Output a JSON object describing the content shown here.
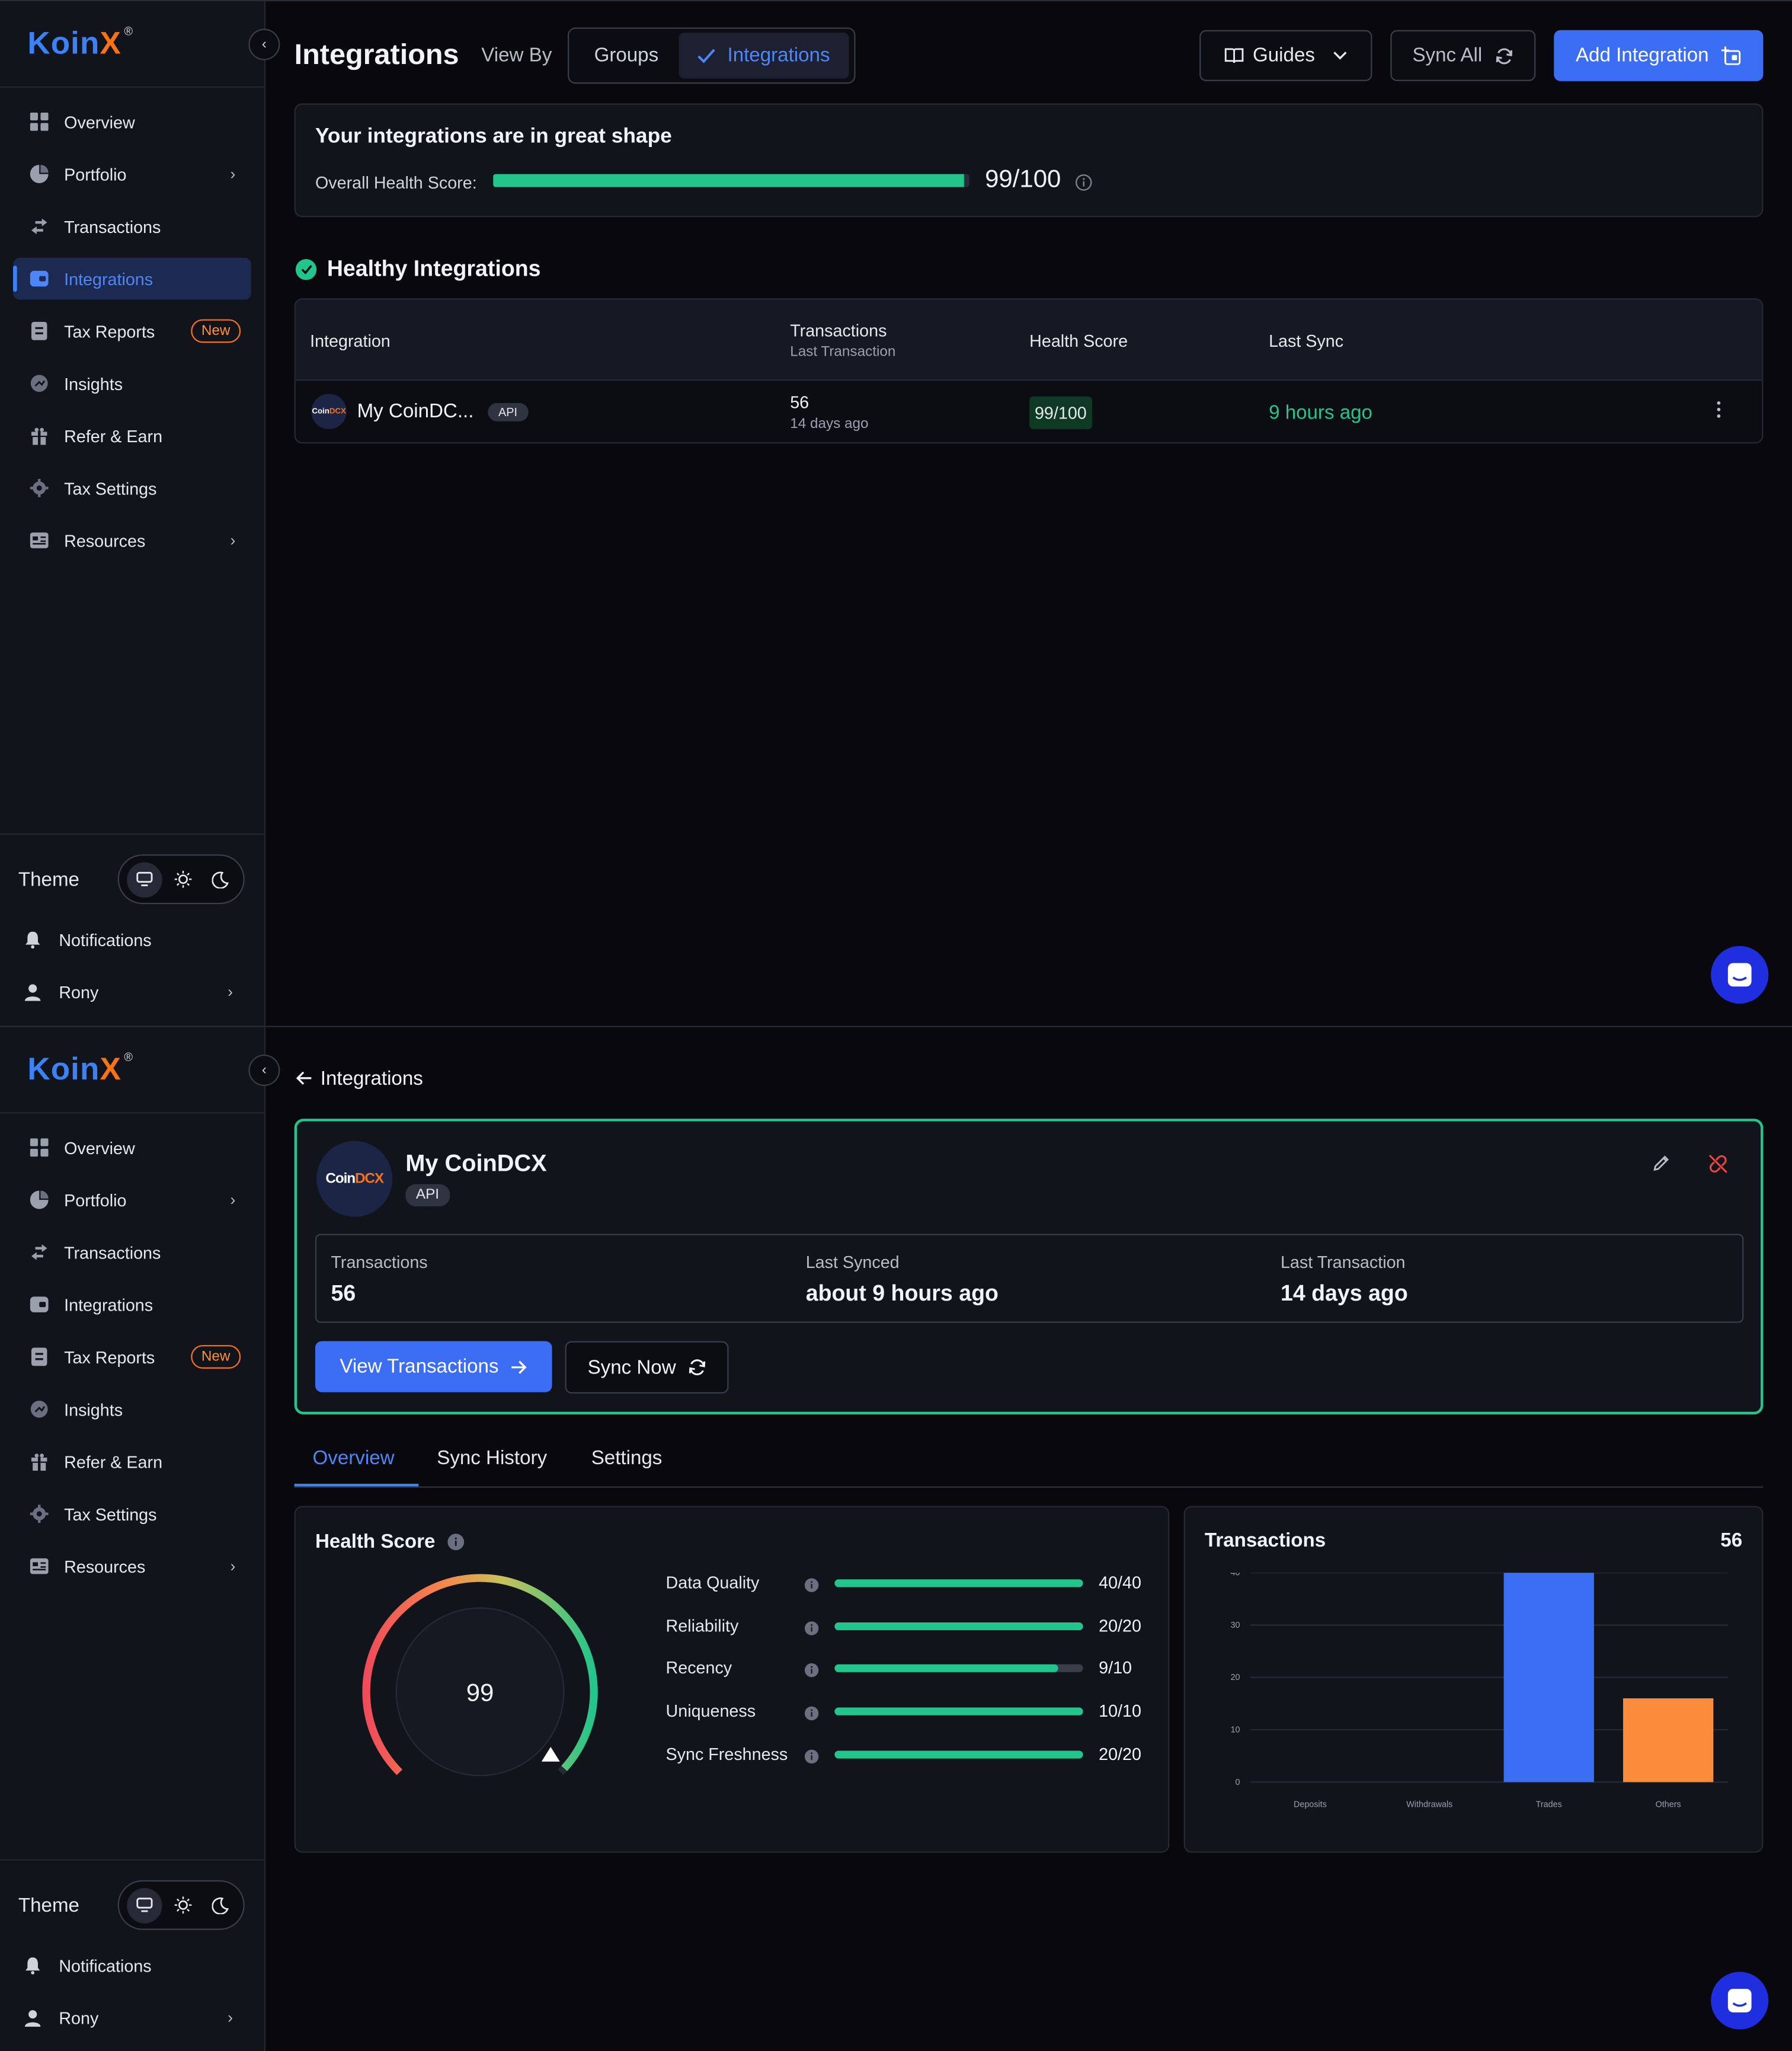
{
  "brand": {
    "name_prefix": "Koin",
    "name_suffix": "X",
    "reg": "®"
  },
  "sidebar": {
    "items": [
      {
        "label": "Overview",
        "icon": "overview-icon"
      },
      {
        "label": "Portfolio",
        "icon": "portfolio-icon",
        "has_submenu": true
      },
      {
        "label": "Transactions",
        "icon": "transactions-icon"
      },
      {
        "label": "Integrations",
        "icon": "integrations-icon"
      },
      {
        "label": "Tax Reports",
        "icon": "tax-reports-icon",
        "badge": "New"
      },
      {
        "label": "Insights",
        "icon": "insights-icon"
      },
      {
        "label": "Refer & Earn",
        "icon": "gift-icon"
      },
      {
        "label": "Tax Settings",
        "icon": "settings-icon"
      },
      {
        "label": "Resources",
        "icon": "resources-icon",
        "has_submenu": true
      }
    ],
    "theme_label": "Theme",
    "theme_options": [
      "system",
      "light",
      "dark"
    ],
    "notifications_label": "Notifications",
    "user_name": "Rony"
  },
  "list_view": {
    "title": "Integrations",
    "view_by_label": "View By",
    "view_options": [
      "Groups",
      "Integrations"
    ],
    "selected_view": "Integrations",
    "guides_label": "Guides",
    "sync_all_label": "Sync All",
    "add_integration_label": "Add Integration",
    "health": {
      "title": "Your integrations are in great shape",
      "score_label": "Overall Health Score:",
      "score_text": "99/100",
      "score_fraction": 0.99
    },
    "section_title": "Healthy Integrations",
    "table": {
      "headers": {
        "integration": "Integration",
        "transactions": "Transactions",
        "transactions_sub": "Last Transaction",
        "health_score": "Health Score",
        "last_sync": "Last Sync"
      },
      "rows": [
        {
          "name": "My CoinDC...",
          "type": "API",
          "transactions": "56",
          "last_transaction": "14 days ago",
          "health_score": "99/100",
          "last_sync": "9 hours ago"
        }
      ]
    }
  },
  "detail_view": {
    "back_label": "Integrations",
    "name": "My CoinDCX",
    "type": "API",
    "logo_text_a": "Coin",
    "logo_text_b": "DCX",
    "stats": [
      {
        "label": "Transactions",
        "value": "56"
      },
      {
        "label": "Last Synced",
        "value": "about 9 hours ago"
      },
      {
        "label": "Last Transaction",
        "value": "14 days ago"
      }
    ],
    "view_transactions_label": "View Transactions",
    "sync_now_label": "Sync Now",
    "tabs": [
      "Overview",
      "Sync History",
      "Settings"
    ],
    "active_tab": "Overview",
    "health_score": {
      "title": "Health Score",
      "value": "99",
      "fraction": 0.99,
      "metrics": [
        {
          "label": "Data Quality",
          "value": "40/40",
          "fraction": 1.0
        },
        {
          "label": "Reliability",
          "value": "20/20",
          "fraction": 1.0
        },
        {
          "label": "Recency",
          "value": "9/10",
          "fraction": 0.9
        },
        {
          "label": "Uniqueness",
          "value": "10/10",
          "fraction": 1.0
        },
        {
          "label": "Sync Freshness",
          "value": "20/20",
          "fraction": 1.0
        }
      ]
    },
    "transactions_card": {
      "title": "Transactions",
      "total": "56"
    }
  },
  "chart_data": {
    "type": "bar",
    "categories": [
      "Deposits",
      "Withdrawals",
      "Trades",
      "Others"
    ],
    "values": [
      0,
      0,
      40,
      16
    ],
    "colors": [
      "#3b6ef5",
      "#3b6ef5",
      "#3b6ef5",
      "#fb8c3c"
    ],
    "yticks": [
      0,
      10,
      20,
      30,
      40
    ],
    "ylim": [
      0,
      40
    ],
    "grid": true
  },
  "colors": {
    "accent": "#3b6ef5",
    "healthy": "#22c58b",
    "badge_new": "#f97316",
    "danger": "#ef4444"
  }
}
